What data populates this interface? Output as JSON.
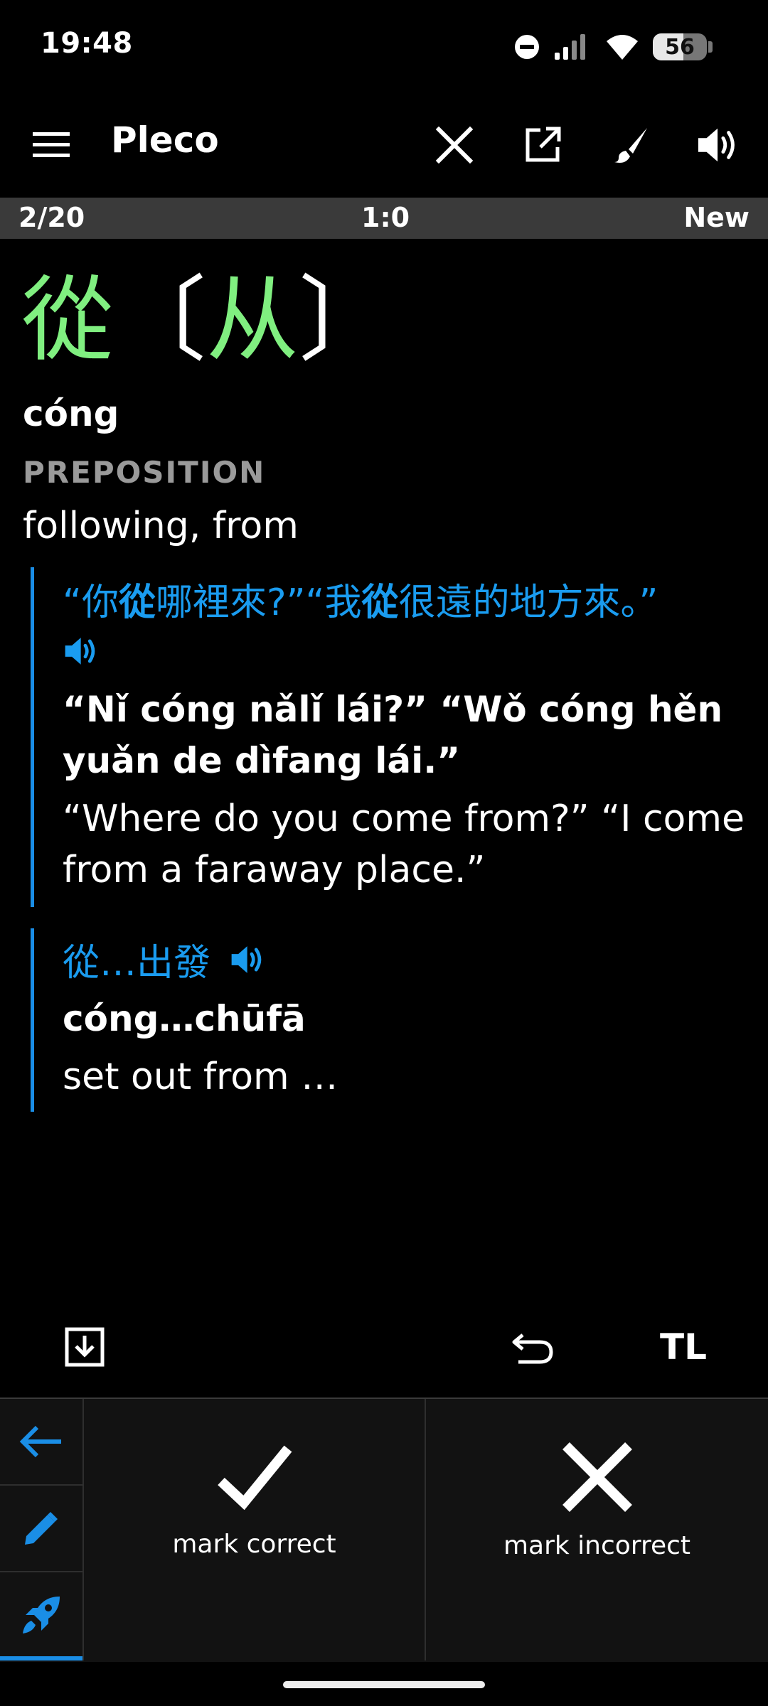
{
  "status": {
    "time": "19:48",
    "battery": "56",
    "battery_percent": 56
  },
  "toolbar": {
    "title": "Pleco"
  },
  "progress": {
    "count": "2/20",
    "score": "1:0",
    "state": "New"
  },
  "entry": {
    "trad": "從",
    "simp": "从",
    "pinyin": "cóng",
    "pos": "PREPOSITION",
    "definition": "following, from"
  },
  "examples": [
    {
      "cn_parts": [
        "“你",
        "從",
        "哪裡來?”“我",
        "從",
        "很遠的地方來。”"
      ],
      "py_parts": [
        "“Nǐ ",
        "cóng",
        " nǎlǐ lái?” “Wǒ ",
        "cóng",
        " hěn yuǎn de dìfang lái.”"
      ],
      "en": "“Where do you come from?” “I come from a faraway place.”"
    },
    {
      "cn": "從…出發",
      "py": "cóng…chūfā",
      "en": "set out from …"
    }
  ],
  "actions": {
    "tl_label": "TL"
  },
  "panel": {
    "correct_label": "mark correct",
    "incorrect_label": "mark incorrect"
  },
  "colors": {
    "accent_blue": "#1a8ee6",
    "headword_green": "#80ef80",
    "strip_gray": "#3a3a3a"
  },
  "icons": [
    "menu-icon",
    "close-icon",
    "open-external-icon",
    "brush-icon",
    "speaker-icon",
    "save-down-icon",
    "undo-icon",
    "arrow-left-icon",
    "pencil-icon",
    "rocket-icon",
    "check-icon",
    "cross-icon"
  ]
}
